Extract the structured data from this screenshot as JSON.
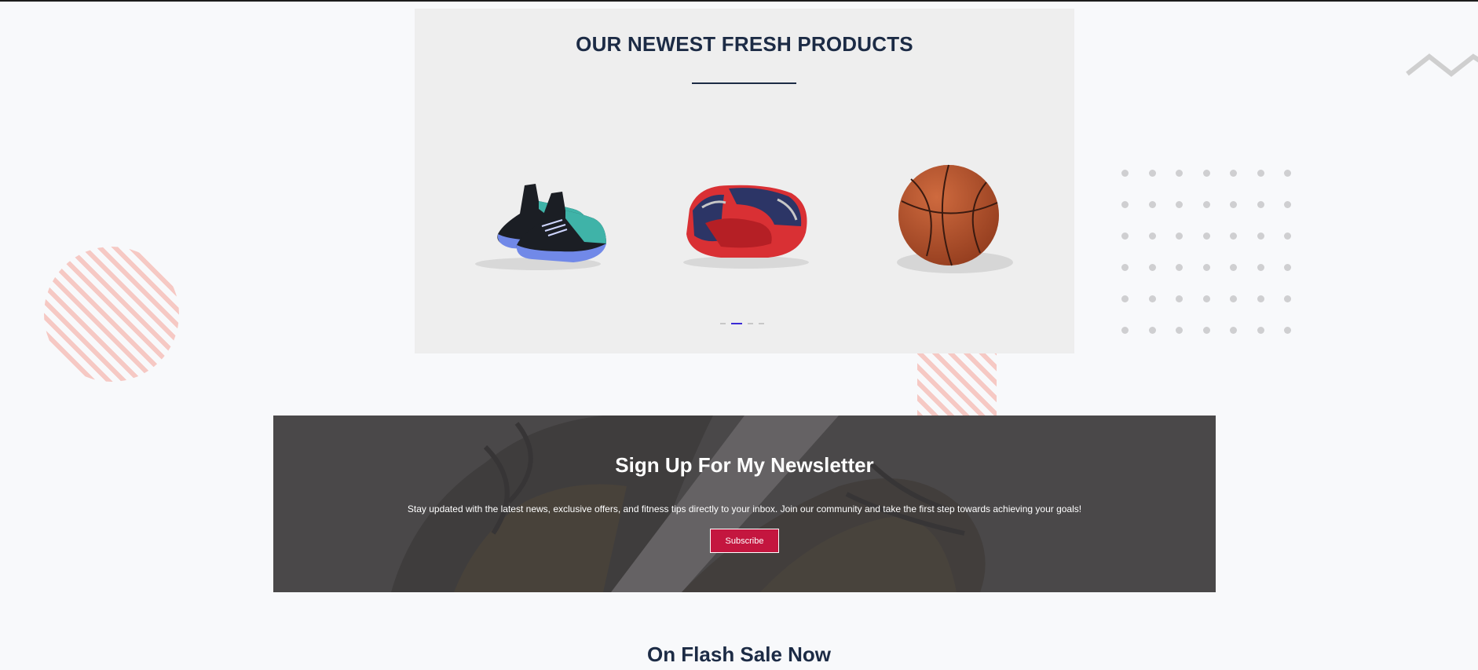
{
  "products": {
    "title": "OUR NEWEST FRESH PRODUCTS",
    "items": [
      {
        "icon": "sneakers-icon"
      },
      {
        "icon": "hockey-glove-icon"
      },
      {
        "icon": "basketball-icon"
      }
    ],
    "carousel": {
      "total_pages": 4,
      "active_page": 2
    }
  },
  "newsletter": {
    "title": "Sign Up For My Newsletter",
    "description": "Stay updated with the latest news, exclusive offers, and fitness tips directly to your inbox. Join our community and take the first step towards achieving your goals!",
    "button_label": "Subscribe"
  },
  "flash_sale": {
    "title": "On Flash Sale Now"
  },
  "colors": {
    "accent": "#c4163f",
    "heading": "#1c2b45",
    "carousel_active": "#3b2bd6",
    "stripe": "#f6c9c4",
    "page_bg": "#f8f9fb",
    "panel_bg": "#eeeeee"
  }
}
